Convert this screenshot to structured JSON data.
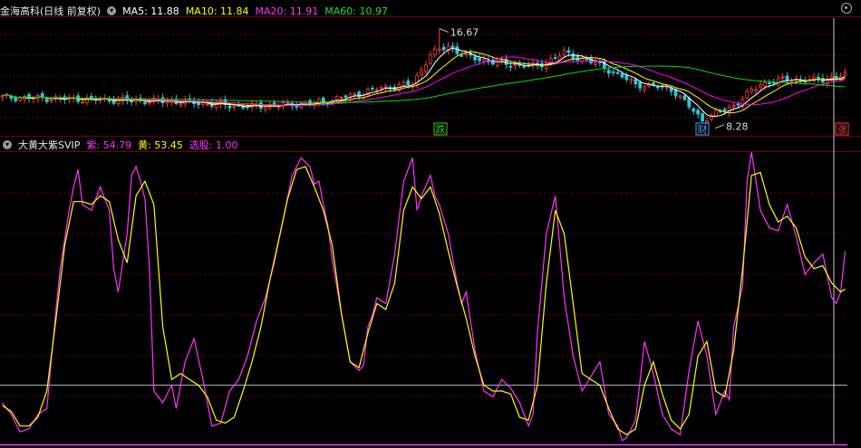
{
  "colors": {
    "background": "#000000",
    "grid": "#7a0000",
    "up": "#ff3b3b",
    "down": "#2ec7d9",
    "ma5": "#ffffff",
    "ma10": "#ffff00",
    "ma20": "#ff00ff",
    "ma60": "#00dd00",
    "purple": "#ff33ff",
    "yellow": "#ffff00"
  },
  "top": {
    "title": "金海高科(日线 前复权)",
    "ma5_label": "MA5: 11.88",
    "ma10_label": "MA10: 11.84",
    "ma20_label": "MA20: 11.91",
    "ma60_label": "MA60: 10.97",
    "high_label": "16.67",
    "low_label": "8.28",
    "mark_fall": "跌",
    "mark_fin": "财",
    "mark_rise": "涨",
    "chevron_icon": "chevron-down-icon",
    "settings_icon": "gear-icon"
  },
  "bottom": {
    "title": "大黄大紫SVIP",
    "purple_label": "紫: 54.79",
    "yellow_label": "黄: 53.45",
    "select_label": "选股: 1.00"
  },
  "chart_data": [
    {
      "type": "candlestick",
      "title": "金海高科(日线 前复权)",
      "n_bars": 190,
      "price_range": [
        8.28,
        16.67
      ],
      "annotations": [
        {
          "text": "16.67",
          "bar": 98,
          "value": 16.67
        },
        {
          "text": "8.28",
          "bar": 157,
          "value": 8.28
        }
      ],
      "key_close_points": [
        {
          "bar": 0,
          "close": 10.9
        },
        {
          "bar": 20,
          "close": 10.7
        },
        {
          "bar": 40,
          "close": 10.5
        },
        {
          "bar": 55,
          "close": 10.1
        },
        {
          "bar": 70,
          "close": 10.4
        },
        {
          "bar": 78,
          "close": 11.0
        },
        {
          "bar": 84,
          "close": 11.6
        },
        {
          "bar": 92,
          "close": 12.0
        },
        {
          "bar": 96,
          "close": 14.5
        },
        {
          "bar": 100,
          "close": 15.2
        },
        {
          "bar": 104,
          "close": 14.3
        },
        {
          "bar": 112,
          "close": 13.7
        },
        {
          "bar": 120,
          "close": 13.5
        },
        {
          "bar": 126,
          "close": 14.6
        },
        {
          "bar": 134,
          "close": 13.6
        },
        {
          "bar": 142,
          "close": 12.0
        },
        {
          "bar": 150,
          "close": 11.6
        },
        {
          "bar": 157,
          "close": 9.0
        },
        {
          "bar": 164,
          "close": 10.2
        },
        {
          "bar": 170,
          "close": 12.0
        },
        {
          "bar": 176,
          "close": 12.4
        },
        {
          "bar": 182,
          "close": 12.3
        },
        {
          "bar": 189,
          "close": 12.7
        }
      ],
      "series": [
        {
          "name": "MA5",
          "last": 11.88
        },
        {
          "name": "MA10",
          "last": 11.84
        },
        {
          "name": "MA20",
          "last": 11.91
        },
        {
          "name": "MA60",
          "last": 10.97
        }
      ]
    },
    {
      "type": "line",
      "title": "大黄大紫SVIP",
      "ylim": [
        0,
        100
      ],
      "reference_line": 20,
      "series": [
        {
          "name": "紫",
          "last": 54.79,
          "x": [
            0,
            2,
            4,
            6,
            8,
            10,
            12,
            13,
            15,
            16,
            17,
            18,
            20,
            22,
            24,
            25,
            26,
            28,
            29,
            30,
            31,
            32,
            33,
            34,
            36,
            38,
            39,
            41,
            43,
            45,
            47,
            49,
            51,
            53,
            55,
            57,
            59,
            61,
            63,
            65,
            67,
            69,
            70,
            71,
            72,
            73,
            74,
            76,
            78,
            80,
            81,
            82,
            83,
            84,
            86,
            88,
            90,
            92,
            93,
            94,
            96,
            97,
            98,
            100,
            102,
            103,
            104,
            106,
            108,
            110,
            112,
            114,
            116,
            118,
            119,
            120,
            122,
            124,
            125,
            126,
            128,
            130,
            132,
            134,
            136,
            138,
            139,
            140,
            142,
            144,
            146,
            148,
            150,
            152,
            154,
            156,
            158,
            160,
            162,
            163,
            164,
            166,
            167,
            168,
            170,
            172,
            174,
            176,
            178,
            180,
            182,
            184,
            186,
            187,
            188,
            189
          ],
          "values": [
            14,
            10,
            4,
            5,
            10,
            12,
            45,
            60,
            80,
            88,
            94,
            82,
            80,
            88,
            80,
            60,
            52,
            72,
            92,
            95,
            90,
            84,
            60,
            18,
            14,
            20,
            12,
            28,
            36,
            22,
            6,
            7,
            18,
            22,
            30,
            42,
            50,
            62,
            77,
            92,
            98,
            95,
            89,
            90,
            82,
            75,
            63,
            45,
            28,
            25,
            27,
            40,
            44,
            50,
            48,
            65,
            90,
            98,
            80,
            85,
            92,
            85,
            82,
            72,
            55,
            48,
            52,
            32,
            18,
            16,
            22,
            19,
            14,
            6,
            10,
            38,
            72,
            85,
            68,
            50,
            30,
            18,
            23,
            28,
            10,
            6,
            1,
            2,
            8,
            35,
            24,
            10,
            5,
            3,
            25,
            42,
            30,
            10,
            18,
            15,
            40,
            54,
            90,
            100,
            80,
            74,
            73,
            82,
            71,
            58,
            62,
            65,
            50,
            48,
            52,
            66
          ]
        },
        {
          "name": "黄",
          "last": 53.45,
          "x": [
            0,
            2,
            4,
            6,
            8,
            10,
            12,
            14,
            16,
            18,
            20,
            22,
            24,
            26,
            28,
            30,
            32,
            34,
            36,
            38,
            40,
            42,
            44,
            46,
            48,
            50,
            52,
            54,
            56,
            58,
            60,
            62,
            64,
            66,
            68,
            70,
            72,
            74,
            76,
            78,
            80,
            82,
            84,
            86,
            88,
            90,
            92,
            94,
            96,
            98,
            100,
            102,
            104,
            106,
            108,
            110,
            112,
            114,
            116,
            118,
            120,
            122,
            124,
            126,
            128,
            130,
            132,
            134,
            136,
            138,
            140,
            142,
            144,
            146,
            148,
            150,
            152,
            154,
            156,
            158,
            160,
            162,
            164,
            166,
            168,
            170,
            172,
            174,
            176,
            178,
            180,
            182,
            184,
            186,
            188,
            189
          ],
          "values": [
            13,
            11,
            6,
            6,
            9,
            18,
            42,
            68,
            83,
            83,
            82,
            85,
            83,
            70,
            62,
            85,
            90,
            82,
            40,
            22,
            24,
            22,
            20,
            16,
            8,
            7,
            9,
            18,
            28,
            40,
            56,
            70,
            84,
            94,
            95,
            88,
            80,
            68,
            45,
            28,
            26,
            38,
            48,
            46,
            55,
            80,
            88,
            84,
            88,
            79,
            66,
            54,
            43,
            30,
            20,
            18,
            18,
            17,
            9,
            8,
            20,
            55,
            80,
            72,
            48,
            24,
            22,
            20,
            12,
            5,
            3,
            5,
            20,
            28,
            17,
            8,
            5,
            10,
            30,
            35,
            18,
            16,
            32,
            60,
            92,
            93,
            82,
            76,
            78,
            74,
            64,
            60,
            61,
            55,
            52,
            53
          ]
        }
      ]
    }
  ]
}
